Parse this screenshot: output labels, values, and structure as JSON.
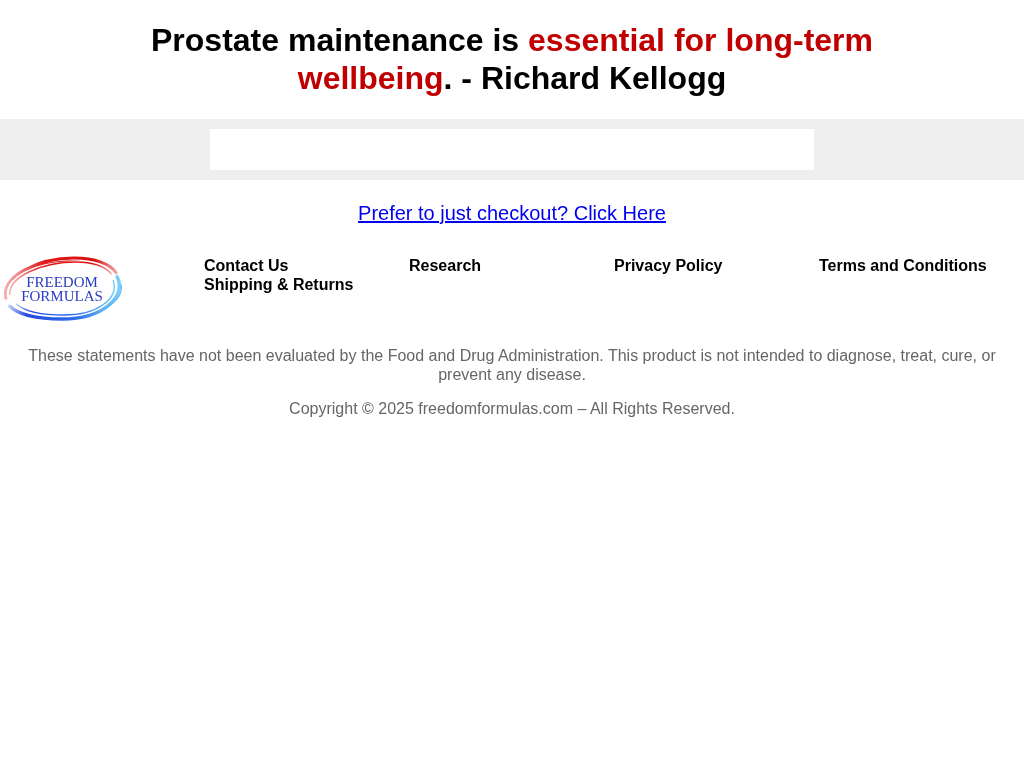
{
  "headline": {
    "segments": [
      {
        "text": "Prostate maintenance is ",
        "emphasis": false
      },
      {
        "text": "essential for long-term wellbeing",
        "emphasis": true
      },
      {
        "text": ". - Richard Kellogg",
        "emphasis": false
      }
    ]
  },
  "checkout_link": {
    "label": "Prefer to just checkout? Click Here"
  },
  "logo": {
    "text": "FREEDOM FORMULAS"
  },
  "footer_links": [
    {
      "label": "Contact Us"
    },
    {
      "label": "Research"
    },
    {
      "label": "Privacy Policy"
    },
    {
      "label": "Terms and Conditions"
    },
    {
      "label": "Shipping & Returns"
    }
  ],
  "disclaimer": "These statements have not been evaluated by the Food and Drug Administration. This product is not intended to diagnose, treat, cure, or prevent any disease.",
  "copyright": "Copyright © 2025 freedomformulas.com – All Rights Reserved."
}
